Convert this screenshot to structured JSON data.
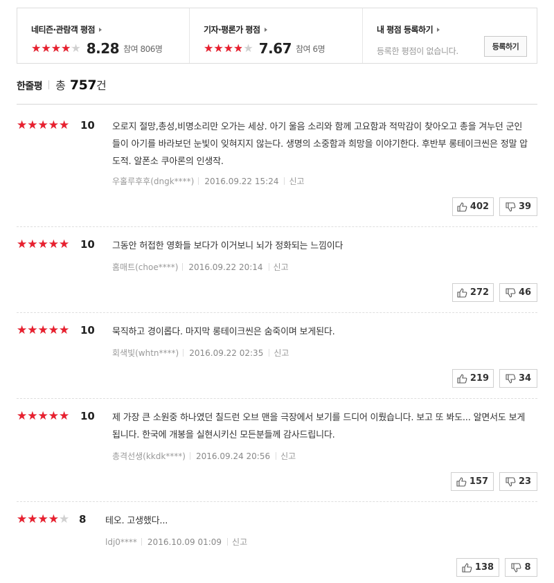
{
  "summary": {
    "netizen": {
      "title": "네티즌·관람객 평점",
      "score": "8.28",
      "participants": "참여 806명",
      "rating_fraction": 0.828
    },
    "critic": {
      "title": "기자·평론가 평점",
      "score": "7.67",
      "participants": "참여 6명",
      "rating_fraction": 0.767
    },
    "mine": {
      "title": "내 평점 등록하기",
      "text": "등록한 평점이 없습니다.",
      "button": "등록하기"
    }
  },
  "list": {
    "title": "한줄평",
    "total_label": "총",
    "count": "757",
    "unit": "건"
  },
  "reviews": [
    {
      "score": "10",
      "rating_fraction": 1.0,
      "text": "오로지 절망,총성,비명소리만 오가는 세상. 아기 울음 소리와 함께 고요함과 적막감이 찾아오고 총을 겨누던 군인들이 아기를 바라보던 눈빛이 잊혀지지 않는다. 생명의 소중함과 희망을 이야기한다. 후반부 롱테이크씬은 정말 압도적. 알폰소 쿠아론의 인생작.",
      "author": "우홀루후후(dngk****)",
      "date": "2016.09.22 15:24",
      "report": "신고",
      "likes": "402",
      "dislikes": "39"
    },
    {
      "score": "10",
      "rating_fraction": 1.0,
      "text": "그동안 허접한 영화들 보다가 이거보니 뇌가 정화되는 느낌이다",
      "author": "홈매트(choe****)",
      "date": "2016.09.22 20:14",
      "report": "신고",
      "likes": "272",
      "dislikes": "46"
    },
    {
      "score": "10",
      "rating_fraction": 1.0,
      "text": "묵직하고 경이롭다. 마지막 롱테이크씬은 숨죽이며 보게된다.",
      "author": "회색빛(whtn****)",
      "date": "2016.09.22 02:35",
      "report": "신고",
      "likes": "219",
      "dislikes": "34"
    },
    {
      "score": "10",
      "rating_fraction": 1.0,
      "text": "제 가장 큰 소원중 하나였던 칠드런 오브 맨을 극장에서 보기를 드디어 이뤘습니다. 보고 또 봐도... 알면서도 보게됩니다. 한국에 개봉을 실현시키신 모든분들께 감사드립니다.",
      "author": "총격선생(kkdk****)",
      "date": "2016.09.24 20:56",
      "report": "신고",
      "likes": "157",
      "dislikes": "23"
    },
    {
      "score": "8",
      "rating_fraction": 0.8,
      "text": "테오. 고생했다...",
      "author": "ldj0****",
      "date": "2016.10.09 01:09",
      "report": "신고",
      "likes": "138",
      "dislikes": "8"
    }
  ],
  "colors": {
    "star": "#e8202f",
    "star_empty": "#d0d0d0"
  },
  "icons": {
    "like": "thumbs-up-icon",
    "dislike": "thumbs-down-icon"
  }
}
